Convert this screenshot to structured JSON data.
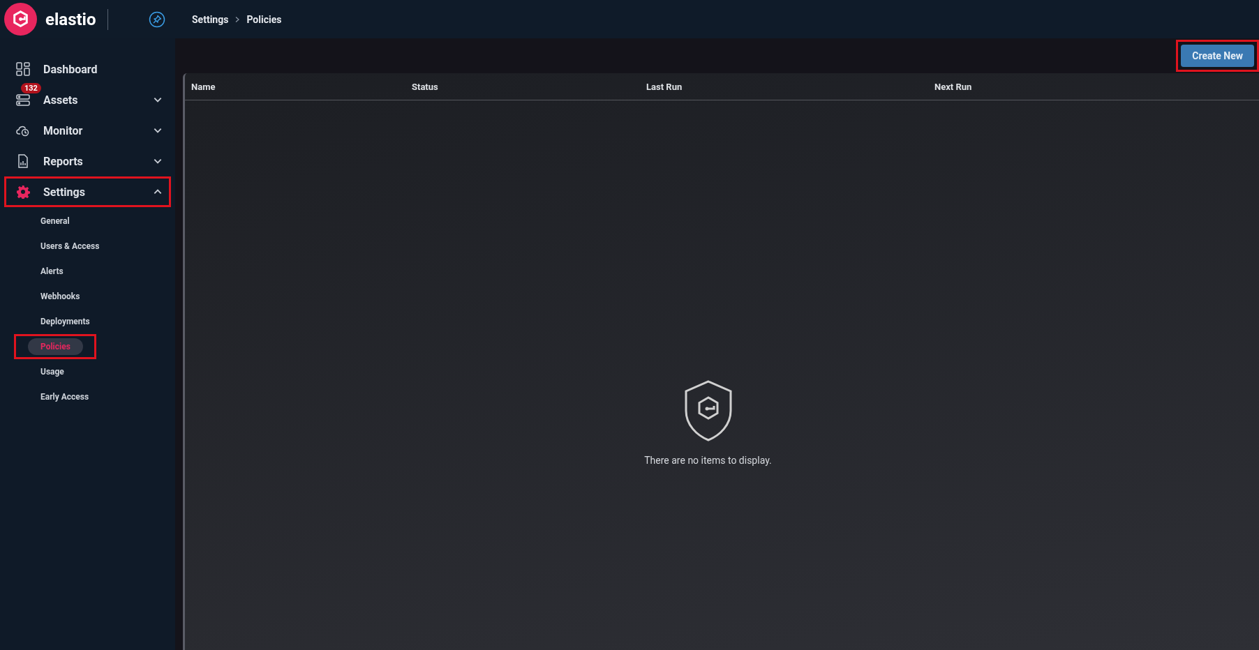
{
  "brand": {
    "name": "elastio"
  },
  "breadcrumb": [
    "Settings",
    "Policies"
  ],
  "sidebar": {
    "items": [
      {
        "label": "Dashboard",
        "selected": false
      },
      {
        "label": "Assets",
        "expanded": false,
        "selected": false,
        "badge": "132"
      },
      {
        "label": "Monitor",
        "expanded": false,
        "selected": false
      },
      {
        "label": "Reports",
        "expanded": false,
        "selected": false
      },
      {
        "label": "Settings",
        "expanded": true,
        "selected": true,
        "annotated": true,
        "children": [
          {
            "label": "General",
            "selected": false
          },
          {
            "label": "Users & Access",
            "selected": false
          },
          {
            "label": "Alerts",
            "selected": false
          },
          {
            "label": "Webhooks",
            "selected": false
          },
          {
            "label": "Deployments",
            "selected": false
          },
          {
            "label": "Policies",
            "selected": true,
            "annotated": true
          },
          {
            "label": "Usage",
            "selected": false
          },
          {
            "label": "Early Access",
            "selected": false
          }
        ]
      }
    ]
  },
  "create_button": {
    "label": "Create New",
    "annotated": true
  },
  "table": {
    "columns": [
      "Name",
      "Status",
      "Last Run",
      "Next Run"
    ],
    "empty_message": "There are no items to display."
  }
}
